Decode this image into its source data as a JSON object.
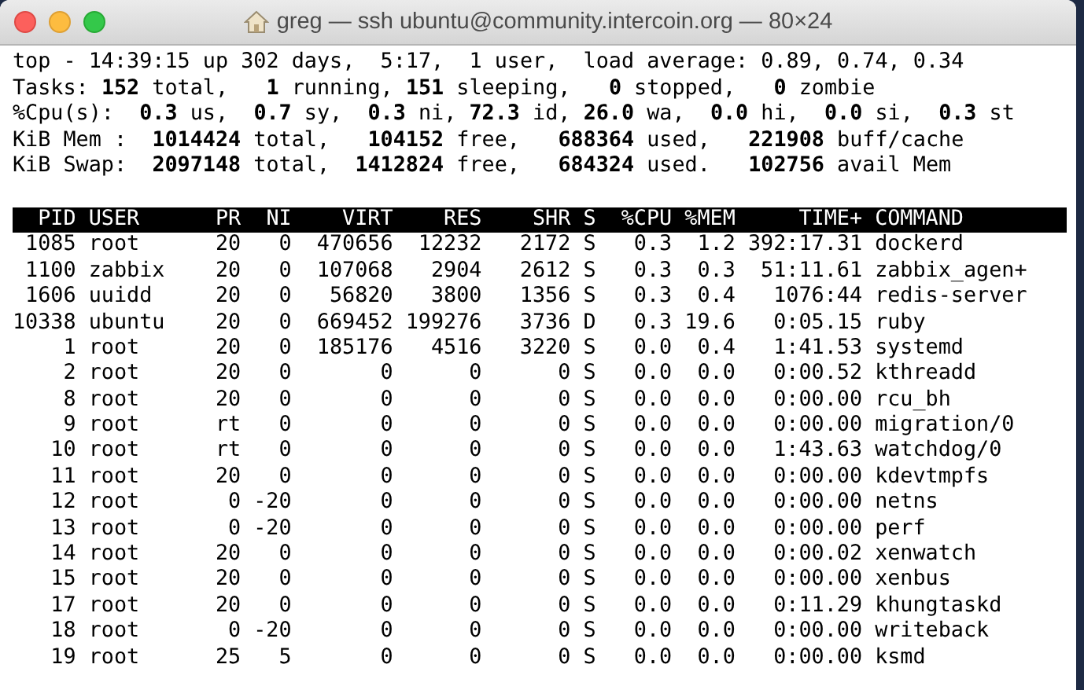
{
  "window": {
    "title": "greg — ssh ubuntu@community.intercoin.org — 80×24"
  },
  "summary": [
    "top - 14:39:15 up 302 days,  5:17,  1 user,  load average: 0.89, 0.74, 0.34",
    "Tasks: **152** total,   **1** running, **151** sleeping,   **0** stopped,   **0** zombie",
    "%Cpu(s):  **0.3** us,  **0.7** sy,  **0.3** ni, **72.3** id, **26.0** wa,  **0.0** hi,  **0.0** si,  **0.3** st",
    "KiB Mem :  **1014424** total,   **104152** free,   **688364** used,   **221908** buff/cache",
    "KiB Swap:  **2097148** total,  **1412824** free,   **684324** used.   **102756** avail Mem"
  ],
  "table": {
    "columns": [
      "PID",
      "USER",
      "PR",
      "NI",
      "VIRT",
      "RES",
      "SHR",
      "S",
      "%CPU",
      "%MEM",
      "TIME+",
      "COMMAND"
    ],
    "rows": [
      [
        "1085",
        "root",
        "20",
        "0",
        "470656",
        "12232",
        "2172",
        "S",
        "0.3",
        "1.2",
        "392:17.31",
        "dockerd"
      ],
      [
        "1100",
        "zabbix",
        "20",
        "0",
        "107068",
        "2904",
        "2612",
        "S",
        "0.3",
        "0.3",
        "51:11.61",
        "zabbix_agen+"
      ],
      [
        "1606",
        "uuidd",
        "20",
        "0",
        "56820",
        "3800",
        "1356",
        "S",
        "0.3",
        "0.4",
        "1076:44",
        "redis-server"
      ],
      [
        "10338",
        "ubuntu",
        "20",
        "0",
        "669452",
        "199276",
        "3736",
        "D",
        "0.3",
        "19.6",
        "0:05.15",
        "ruby"
      ],
      [
        "1",
        "root",
        "20",
        "0",
        "185176",
        "4516",
        "3220",
        "S",
        "0.0",
        "0.4",
        "1:41.53",
        "systemd"
      ],
      [
        "2",
        "root",
        "20",
        "0",
        "0",
        "0",
        "0",
        "S",
        "0.0",
        "0.0",
        "0:00.52",
        "kthreadd"
      ],
      [
        "8",
        "root",
        "20",
        "0",
        "0",
        "0",
        "0",
        "S",
        "0.0",
        "0.0",
        "0:00.00",
        "rcu_bh"
      ],
      [
        "9",
        "root",
        "rt",
        "0",
        "0",
        "0",
        "0",
        "S",
        "0.0",
        "0.0",
        "0:00.00",
        "migration/0"
      ],
      [
        "10",
        "root",
        "rt",
        "0",
        "0",
        "0",
        "0",
        "S",
        "0.0",
        "0.0",
        "1:43.63",
        "watchdog/0"
      ],
      [
        "11",
        "root",
        "20",
        "0",
        "0",
        "0",
        "0",
        "S",
        "0.0",
        "0.0",
        "0:00.00",
        "kdevtmpfs"
      ],
      [
        "12",
        "root",
        "0",
        "-20",
        "0",
        "0",
        "0",
        "S",
        "0.0",
        "0.0",
        "0:00.00",
        "netns"
      ],
      [
        "13",
        "root",
        "0",
        "-20",
        "0",
        "0",
        "0",
        "S",
        "0.0",
        "0.0",
        "0:00.00",
        "perf"
      ],
      [
        "14",
        "root",
        "20",
        "0",
        "0",
        "0",
        "0",
        "S",
        "0.0",
        "0.0",
        "0:00.02",
        "xenwatch"
      ],
      [
        "15",
        "root",
        "20",
        "0",
        "0",
        "0",
        "0",
        "S",
        "0.0",
        "0.0",
        "0:00.00",
        "xenbus"
      ],
      [
        "17",
        "root",
        "20",
        "0",
        "0",
        "0",
        "0",
        "S",
        "0.0",
        "0.0",
        "0:11.29",
        "khungtaskd"
      ],
      [
        "18",
        "root",
        "0",
        "-20",
        "0",
        "0",
        "0",
        "S",
        "0.0",
        "0.0",
        "0:00.00",
        "writeback"
      ],
      [
        "19",
        "root",
        "25",
        "5",
        "0",
        "0",
        "0",
        "S",
        "0.0",
        "0.0",
        "0:00.00",
        "ksmd"
      ]
    ]
  }
}
